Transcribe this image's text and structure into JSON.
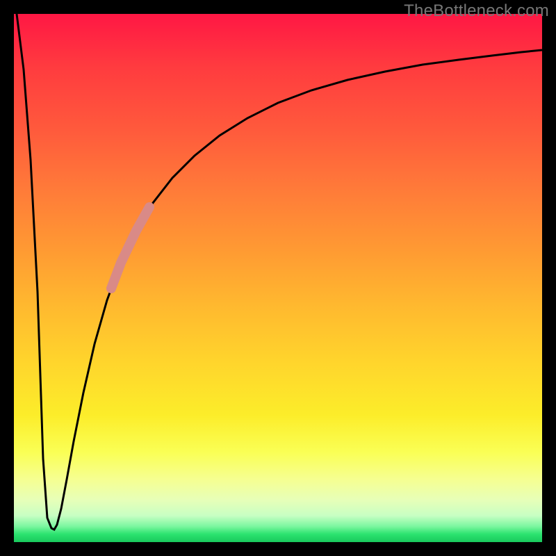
{
  "watermark": {
    "text": "TheBottleneck.com"
  },
  "colors": {
    "curve_stroke": "#000000",
    "highlight_stroke": "#d98a87",
    "frame_bg": "#000000"
  },
  "chart_data": {
    "type": "line",
    "title": "",
    "xlabel": "",
    "ylabel": "",
    "xlim": [
      0,
      100
    ],
    "ylim": [
      0,
      100
    ],
    "grid": false,
    "series": [
      {
        "name": "bottleneck-curve",
        "x": [
          0,
          1,
          2,
          3,
          4,
          5,
          6,
          7,
          8,
          9,
          10,
          12,
          14,
          16,
          18,
          20,
          22,
          25,
          28,
          32,
          36,
          40,
          45,
          50,
          55,
          60,
          65,
          70,
          75,
          80,
          85,
          90,
          95,
          100
        ],
        "y": [
          100,
          85,
          65,
          40,
          12,
          2,
          1,
          3,
          10,
          18,
          26,
          38,
          48,
          55,
          61,
          66,
          70,
          74,
          77,
          80,
          83,
          85,
          87,
          89,
          90.5,
          91.5,
          92.5,
          93,
          93.5,
          94,
          94.4,
          94.7,
          95,
          95.3
        ]
      }
    ],
    "highlight_segment": {
      "series": "bottleneck-curve",
      "x_start": 17,
      "x_end": 25,
      "note": "thicker salmon-colored segment on the rising arm"
    },
    "legend": null
  }
}
